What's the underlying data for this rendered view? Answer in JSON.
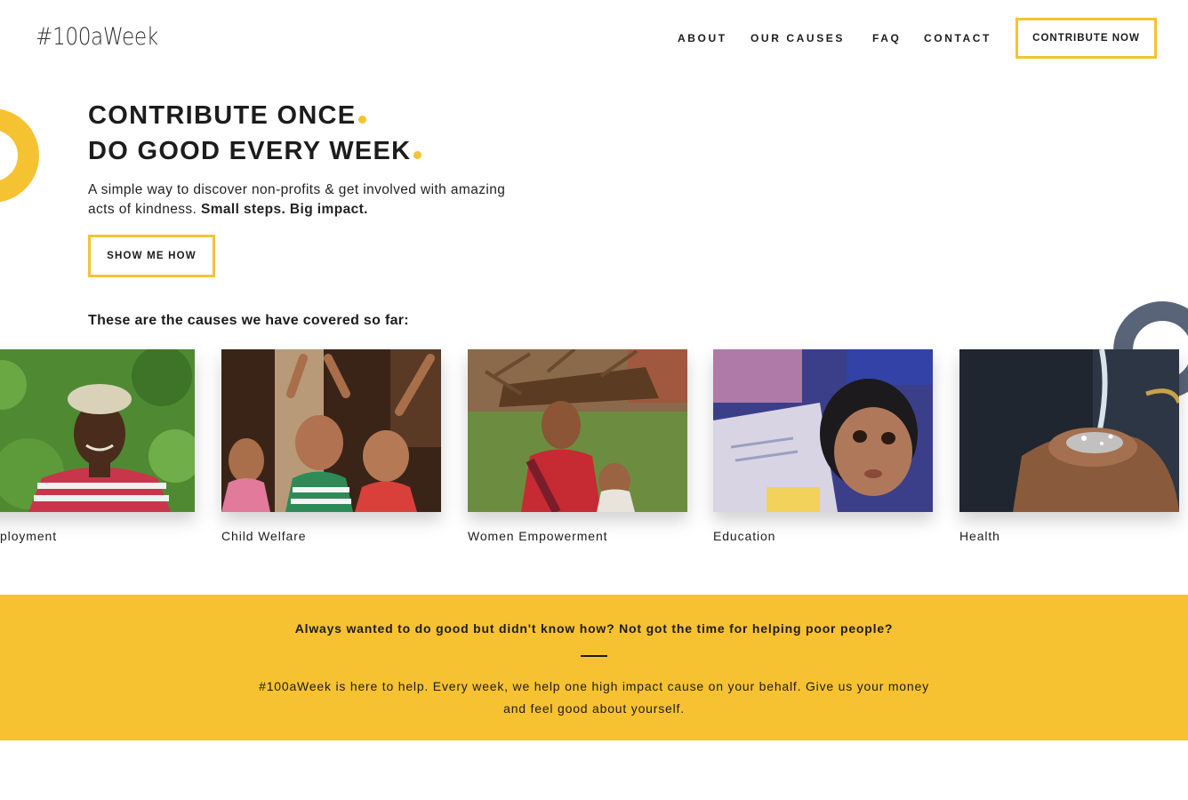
{
  "header": {
    "logo": "#100aWeek",
    "nav": [
      "ABOUT",
      "OUR CAUSES",
      "FAQ",
      "CONTACT"
    ],
    "cta": "CONTRIBUTE NOW"
  },
  "hero": {
    "line1": "CONTRIBUTE ONCE",
    "line2": "DO GOOD EVERY WEEK",
    "subtext": "A simple way to discover non-profits & get involved with amazing acts of kindness.",
    "subtext_bold": "Small steps. Big impact.",
    "button": "SHOW ME HOW"
  },
  "causes": {
    "heading": "These are the causes we have covered so far:",
    "items": [
      {
        "label": "Employment",
        "visible_label": "ployment"
      },
      {
        "label": "Child Welfare"
      },
      {
        "label": "Women Empowerment"
      },
      {
        "label": "Education"
      },
      {
        "label": "Health"
      }
    ]
  },
  "band": {
    "question": "Always wanted to do good but didn't know how? Not got the time for helping poor people?",
    "text": "#100aWeek is here to help. Every week, we help one high impact cause on your behalf. Give us your money and feel good about yourself."
  },
  "colors": {
    "accent": "#f5c232",
    "band": "#f7c231",
    "ring_dark": "#5a6478",
    "text": "#1c1c1c"
  }
}
